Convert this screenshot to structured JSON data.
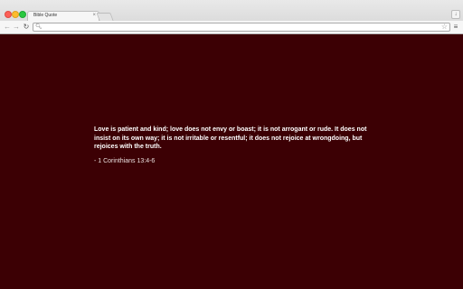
{
  "browser": {
    "tab": {
      "title": "Bible Quote",
      "close_glyph": "×"
    },
    "toolbar": {
      "back_icon": "back-arrow-icon",
      "forward_icon": "forward-arrow-icon",
      "reload_icon": "reload-icon",
      "omnibox_value": "",
      "menu_icon": "hamburger-menu-icon",
      "star_icon": "star-icon",
      "download_icon": "download-icon"
    }
  },
  "page": {
    "background_color": "#3c0004",
    "quote": "Love is patient and kind; love does not envy or boast; it is not arrogant or rude. It does not insist on its own way; it is not irritable or resentful; it does not rejoice at wrongdoing, but rejoices with the truth.",
    "reference": "- 1 Corinthians 13:4-6"
  }
}
